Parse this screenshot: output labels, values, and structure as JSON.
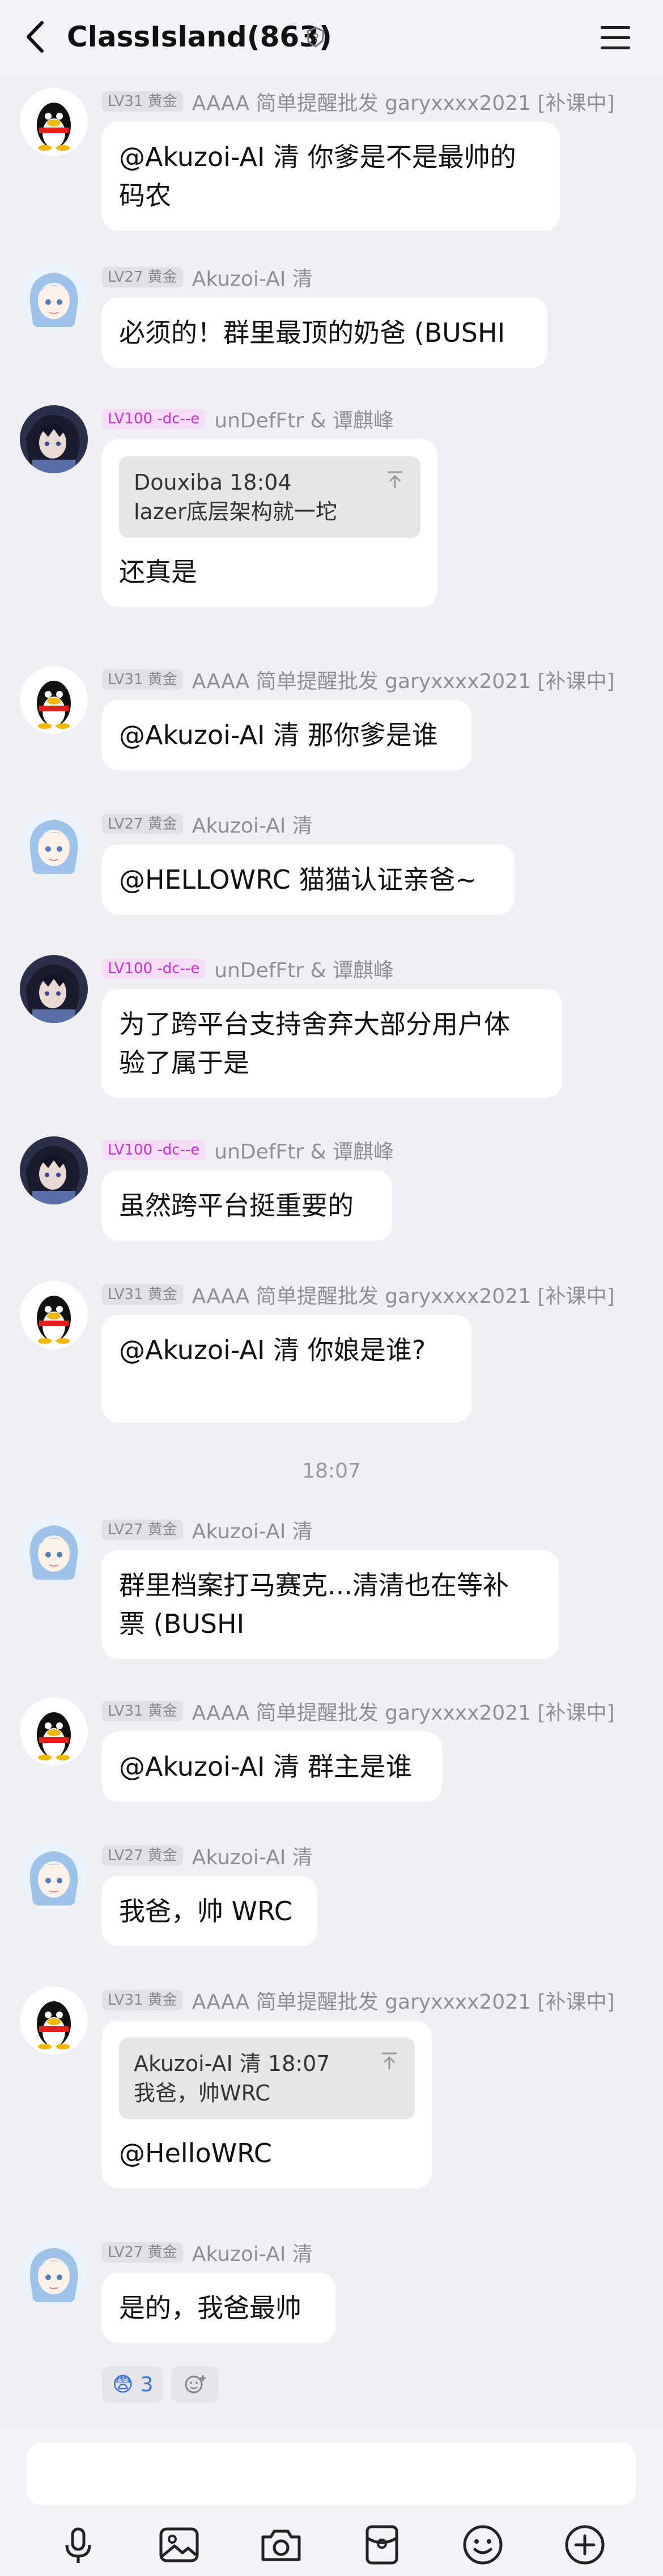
{
  "header": {
    "title": "ClassIsland(863)"
  },
  "colors": {
    "background": "#efeff4",
    "bubble": "#ffffff",
    "lv100_badge_text": "#c236cc",
    "reaction_count": "#3a6fd8"
  },
  "messages": [
    {
      "badge": "LV31 黄金",
      "nick": "AAAA 简单提醒批发 garyxxxx2021 [补课中]",
      "lines": [
        "@Akuzoi-AI 清 你爹是不是最帅的",
        "码农"
      ],
      "avatar": "qq-penguin-avatar"
    },
    {
      "badge": "LV27 黄金",
      "nick": "Akuzoi-AI 清",
      "lines": [
        "必须的！群里最顶的奶爸 (BUSHI"
      ],
      "avatar": "anime-girl-avatar"
    },
    {
      "badge": "LV100 -dc--e",
      "nick": "unDefFtr & 谭麒峰",
      "quote": {
        "head": "Douxiba 18:04",
        "text": "lazer底层架构就一坨"
      },
      "lines": [
        "还真是"
      ],
      "avatar": "dark-anime-avatar"
    },
    {
      "badge": "LV31 黄金",
      "nick": "AAAA 简单提醒批发 garyxxxx2021 [补课中]",
      "lines": [
        "@Akuzoi-AI 清 那你爹是谁"
      ],
      "avatar": "qq-penguin-avatar"
    },
    {
      "badge": "LV27 黄金",
      "nick": "Akuzoi-AI 清",
      "lines": [
        "@HELLOWRC 猫猫认证亲爸~"
      ],
      "avatar": "anime-girl-avatar"
    },
    {
      "badge": "LV100 -dc--e",
      "nick": "unDefFtr & 谭麒峰",
      "lines": [
        "为了跨平台支持舍弃大部分用户体",
        "验了属于是"
      ],
      "avatar": "dark-anime-avatar"
    },
    {
      "badge": "LV100 -dc--e",
      "nick": "unDefFtr & 谭麒峰",
      "lines": [
        "虽然跨平台挺重要的"
      ],
      "avatar": "dark-anime-avatar"
    },
    {
      "badge": "LV31 黄金",
      "nick": "AAAA 简单提醒批发 garyxxxx2021 [补课中]",
      "lines": [
        "@Akuzoi-AI 清 你娘是谁?",
        ""
      ],
      "avatar": "qq-penguin-avatar"
    },
    {
      "badge": "LV27 黄金",
      "nick": "Akuzoi-AI 清",
      "lines": [
        "群里档案打马赛克...清清也在等补",
        "票 (BUSHI"
      ],
      "avatar": "anime-girl-avatar"
    },
    {
      "badge": "LV31 黄金",
      "nick": "AAAA 简单提醒批发 garyxxxx2021 [补课中]",
      "lines": [
        "@Akuzoi-AI 清 群主是谁"
      ],
      "avatar": "qq-penguin-avatar"
    },
    {
      "badge": "LV27 黄金",
      "nick": "Akuzoi-AI 清",
      "lines": [
        "我爸，帅 WRC"
      ],
      "avatar": "anime-girl-avatar"
    },
    {
      "badge": "LV31 黄金",
      "nick": "AAAA 简单提醒批发 garyxxxx2021 [补课中]",
      "quote": {
        "head": "Akuzoi-AI 清 18:07",
        "text": "我爸，帅WRC"
      },
      "lines": [
        "@HelloWRC"
      ],
      "avatar": "qq-penguin-avatar"
    },
    {
      "badge": "LV27 黄金",
      "nick": "Akuzoi-AI 清",
      "lines": [
        "是的，我爸最帅"
      ],
      "avatar": "anime-girl-avatar"
    }
  ],
  "timestamp": "18:07",
  "reaction": {
    "emoji": "😨",
    "count": "3"
  },
  "toolbar": [
    "microphone-icon",
    "image-icon",
    "camera-icon",
    "red-packet-icon",
    "emoji-icon",
    "plus-icon"
  ]
}
